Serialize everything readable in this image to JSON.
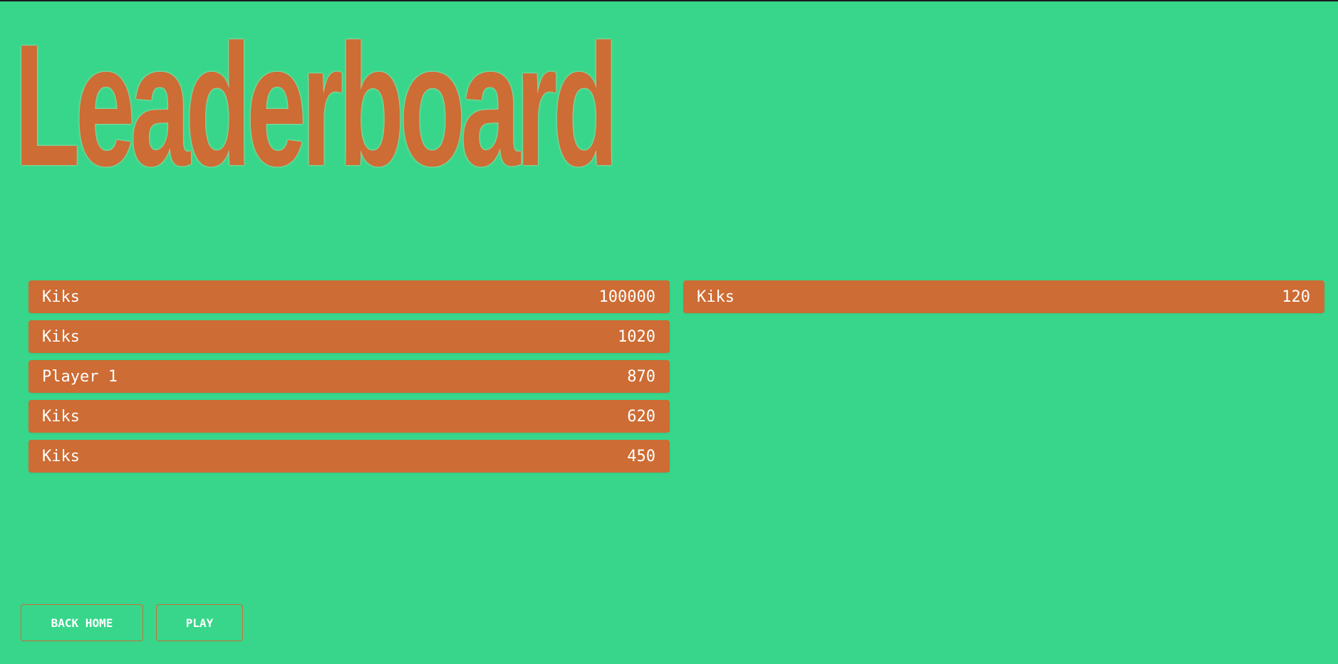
{
  "page": {
    "title": "Leaderboard"
  },
  "leaderboard": {
    "left_column": [
      {
        "name": "Kiks",
        "score": "100000"
      },
      {
        "name": "Kiks",
        "score": "1020"
      },
      {
        "name": "Player 1",
        "score": "870"
      },
      {
        "name": "Kiks",
        "score": "620"
      },
      {
        "name": "Kiks",
        "score": "450"
      }
    ],
    "right_column": [
      {
        "name": "Kiks",
        "score": "120"
      }
    ]
  },
  "buttons": {
    "back_home": "BACK HOME",
    "play": "PLAY"
  },
  "colors": {
    "background": "#37d68b",
    "accent": "#cd6c34",
    "text": "#ffffff"
  }
}
